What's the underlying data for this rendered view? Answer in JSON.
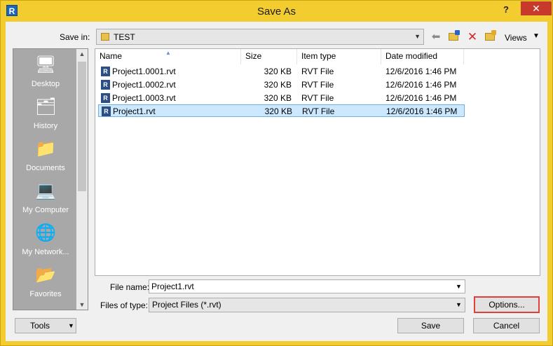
{
  "window": {
    "title": "Save As",
    "app_icon": "R",
    "help": "?",
    "close": "✕"
  },
  "toolbar": {
    "save_in_label": "Save in:",
    "save_in_value": "TEST",
    "views_label": "Views"
  },
  "places": [
    {
      "label": "Desktop",
      "icon": "desktop-icon"
    },
    {
      "label": "History",
      "icon": "history-icon"
    },
    {
      "label": "Documents",
      "icon": "documents-icon"
    },
    {
      "label": "My Computer",
      "icon": "computer-icon"
    },
    {
      "label": "My Network...",
      "icon": "network-icon"
    },
    {
      "label": "Favorites",
      "icon": "favorites-icon"
    }
  ],
  "filelist": {
    "columns": [
      "Name",
      "Size",
      "Item type",
      "Date modified"
    ],
    "rows": [
      {
        "name": "Project1.0001.rvt",
        "size": "320 KB",
        "type": "RVT File",
        "date": "12/6/2016 1:46 PM"
      },
      {
        "name": "Project1.0002.rvt",
        "size": "320 KB",
        "type": "RVT File",
        "date": "12/6/2016 1:46 PM"
      },
      {
        "name": "Project1.0003.rvt",
        "size": "320 KB",
        "type": "RVT File",
        "date": "12/6/2016 1:46 PM"
      },
      {
        "name": "Project1.rvt",
        "size": "320 KB",
        "type": "RVT File",
        "date": "12/6/2016 1:46 PM"
      }
    ]
  },
  "form": {
    "file_name_label": "File name:",
    "file_name_value": "Project1.rvt",
    "file_type_label": "Files of type:",
    "file_type_value": "Project Files  (*.rvt)"
  },
  "buttons": {
    "options": "Options...",
    "tools": "Tools",
    "save": "Save",
    "cancel": "Cancel"
  }
}
